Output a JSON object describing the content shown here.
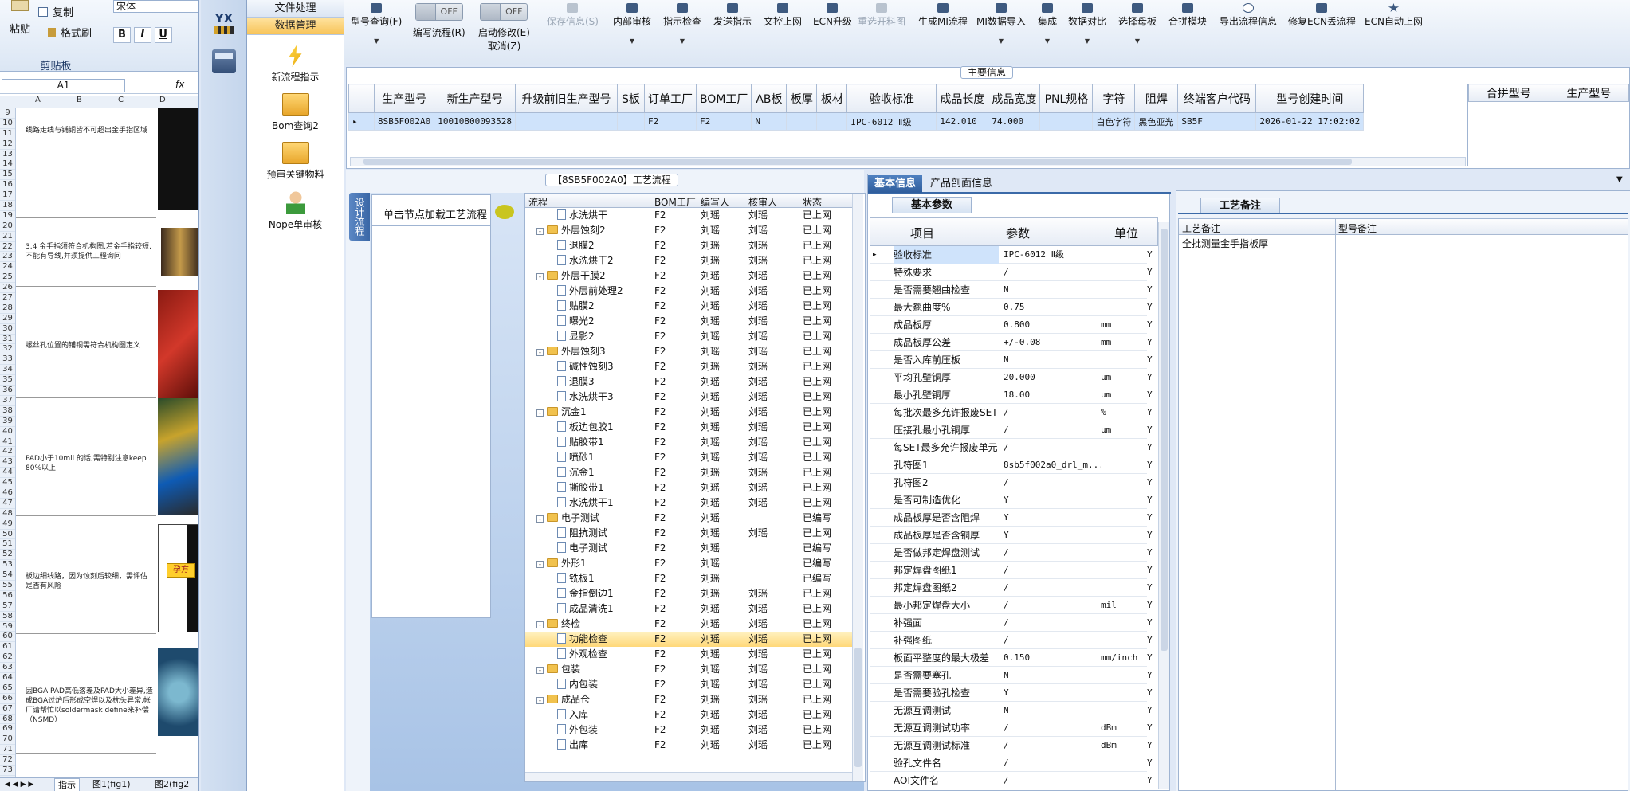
{
  "excel": {
    "copy_label": "复制",
    "format_label": "格式刷",
    "paste_label": "粘贴",
    "font_name": "宋体",
    "clipboard_label": "剪贴板",
    "namebox": "A1",
    "fx": "fx",
    "bold": "B",
    "italic": "I",
    "underline": "U",
    "rows": [
      "9",
      "10",
      "11",
      "12",
      "13",
      "14",
      "15",
      "16",
      "17",
      "18",
      "19",
      "20",
      "21",
      "22",
      "23",
      "24",
      "25",
      "26",
      "27",
      "28",
      "29",
      "30",
      "31",
      "32",
      "33",
      "34",
      "35",
      "36",
      "37",
      "38",
      "39",
      "40",
      "41",
      "42",
      "43",
      "44",
      "45",
      "46",
      "47",
      "48",
      "49",
      "50",
      "51",
      "52",
      "53",
      "54",
      "55",
      "56",
      "57",
      "58",
      "59",
      "60",
      "61",
      "62",
      "63",
      "64",
      "65",
      "66",
      "67",
      "68",
      "69",
      "70",
      "71",
      "72",
      "73"
    ],
    "cols": [
      "A",
      "B",
      "C",
      "D"
    ],
    "notes": [
      "线路走线与铺铜皆不可超出金手指区域",
      "3.4 金手指须符合机构图,若金手指较短,不能有导线,并须提供工程询问",
      "螺丝孔位置的铺铜需符合机构图定义",
      "PAD小于10mil 的话,需特别注意keep 80%以上",
      "板边细线路，因为蚀刻后较细，需评估是否有风险",
      "因BGA PAD高低落差及PAD大小差异,造成BGA过炉后形成空焊以及枕头异常,帐厂请帮忙以soldermask define来补偿（NSMD）"
    ],
    "note_highlight": "（NSMD）",
    "arrow_label": "孕方",
    "sheet_tabs": [
      "指示",
      "图1(fig1)",
      "图2(fig2"
    ]
  },
  "leftnav": {
    "logo": "YX"
  },
  "menu": {
    "header1": "文件处理",
    "header2": "数据管理",
    "items": [
      "新流程指示",
      "Bom查询2",
      "预审关键物料",
      "Nope单审核"
    ]
  },
  "toolbar": {
    "buttons": [
      "型号查询(F)",
      "保存信息(S)",
      "内部审核",
      "指示检查",
      "发送指示",
      "文控上网",
      "ECN升级",
      "重选开料图",
      "生成MI流程",
      "MI数据导入",
      "集成",
      "数据对比",
      "选择母板",
      "合拼模块",
      "导出流程信息",
      "修复ECN丢流程",
      "ECN自动上网"
    ],
    "toggle1_state": "OFF",
    "toggle1_label": "编写流程(R)",
    "toggle2_state": "OFF",
    "toggle2_label": "启动修改(E)",
    "cancel_label": "取消(Z)"
  },
  "main": {
    "title": "主要信息",
    "columns": [
      "生产型号",
      "新生产型号",
      "升级前旧生产型号",
      "S板",
      "订单工厂",
      "BOM工厂",
      "AB板",
      "板厚",
      "板材",
      "验收标准",
      "成品长度",
      "成品宽度",
      "PNL规格",
      "字符",
      "阻焊",
      "终端客户代码",
      "型号创建时间"
    ],
    "row": [
      "8SB5F002A0",
      "10010800093528",
      "",
      "",
      "F2",
      "F2",
      "N",
      "",
      "",
      "IPC-6012 Ⅱ级",
      "142.010",
      "74.000",
      "",
      "白色字符",
      "黑色亚光",
      "SB5F",
      "2026-01-22 17:02:02"
    ],
    "right_columns": [
      "合拼型号",
      "生产型号"
    ]
  },
  "flow": {
    "title": "【8SB5F002A0】工艺流程",
    "side_tab": "设计流程",
    "click_hint": "单击节点加载工艺流程",
    "columns": [
      "流程",
      "BOM工厂",
      "编写人",
      "核审人",
      "状态"
    ],
    "nodes": [
      {
        "name": "水洗烘干",
        "level": 2,
        "type": "doc",
        "bom": "F2",
        "writer": "刘瑶",
        "reviewer": "刘瑶",
        "status": "已上网"
      },
      {
        "name": "外层蚀刻2",
        "level": 1,
        "type": "folder",
        "bom": "F2",
        "writer": "刘瑶",
        "reviewer": "刘瑶",
        "status": "已上网"
      },
      {
        "name": "退膜2",
        "level": 2,
        "type": "doc",
        "bom": "F2",
        "writer": "刘瑶",
        "reviewer": "刘瑶",
        "status": "已上网"
      },
      {
        "name": "水洗烘干2",
        "level": 2,
        "type": "doc",
        "bom": "F2",
        "writer": "刘瑶",
        "reviewer": "刘瑶",
        "status": "已上网"
      },
      {
        "name": "外层干膜2",
        "level": 1,
        "type": "folder",
        "bom": "F2",
        "writer": "刘瑶",
        "reviewer": "刘瑶",
        "status": "已上网"
      },
      {
        "name": "外层前处理2",
        "level": 2,
        "type": "doc",
        "bom": "F2",
        "writer": "刘瑶",
        "reviewer": "刘瑶",
        "status": "已上网"
      },
      {
        "name": "贴膜2",
        "level": 2,
        "type": "doc",
        "bom": "F2",
        "writer": "刘瑶",
        "reviewer": "刘瑶",
        "status": "已上网"
      },
      {
        "name": "曝光2",
        "level": 2,
        "type": "doc",
        "bom": "F2",
        "writer": "刘瑶",
        "reviewer": "刘瑶",
        "status": "已上网"
      },
      {
        "name": "显影2",
        "level": 2,
        "type": "doc",
        "bom": "F2",
        "writer": "刘瑶",
        "reviewer": "刘瑶",
        "status": "已上网"
      },
      {
        "name": "外层蚀刻3",
        "level": 1,
        "type": "folder",
        "bom": "F2",
        "writer": "刘瑶",
        "reviewer": "刘瑶",
        "status": "已上网"
      },
      {
        "name": "碱性蚀刻3",
        "level": 2,
        "type": "doc",
        "bom": "F2",
        "writer": "刘瑶",
        "reviewer": "刘瑶",
        "status": "已上网"
      },
      {
        "name": "退膜3",
        "level": 2,
        "type": "doc",
        "bom": "F2",
        "writer": "刘瑶",
        "reviewer": "刘瑶",
        "status": "已上网"
      },
      {
        "name": "水洗烘干3",
        "level": 2,
        "type": "doc",
        "bom": "F2",
        "writer": "刘瑶",
        "reviewer": "刘瑶",
        "status": "已上网"
      },
      {
        "name": "沉金1",
        "level": 1,
        "type": "folder",
        "bom": "F2",
        "writer": "刘瑶",
        "reviewer": "刘瑶",
        "status": "已上网"
      },
      {
        "name": "板边包胶1",
        "level": 2,
        "type": "doc",
        "bom": "F2",
        "writer": "刘瑶",
        "reviewer": "刘瑶",
        "status": "已上网"
      },
      {
        "name": "贴胶带1",
        "level": 2,
        "type": "doc",
        "bom": "F2",
        "writer": "刘瑶",
        "reviewer": "刘瑶",
        "status": "已上网"
      },
      {
        "name": "喷砂1",
        "level": 2,
        "type": "doc",
        "bom": "F2",
        "writer": "刘瑶",
        "reviewer": "刘瑶",
        "status": "已上网"
      },
      {
        "name": "沉金1",
        "level": 2,
        "type": "doc",
        "bom": "F2",
        "writer": "刘瑶",
        "reviewer": "刘瑶",
        "status": "已上网"
      },
      {
        "name": "撕胶带1",
        "level": 2,
        "type": "doc",
        "bom": "F2",
        "writer": "刘瑶",
        "reviewer": "刘瑶",
        "status": "已上网"
      },
      {
        "name": "水洗烘干1",
        "level": 2,
        "type": "doc",
        "bom": "F2",
        "writer": "刘瑶",
        "reviewer": "刘瑶",
        "status": "已上网"
      },
      {
        "name": "电子测试",
        "level": 1,
        "type": "folder",
        "bom": "F2",
        "writer": "刘瑶",
        "reviewer": "",
        "status": "已编写"
      },
      {
        "name": "阻抗测试",
        "level": 2,
        "type": "doc",
        "bom": "F2",
        "writer": "刘瑶",
        "reviewer": "刘瑶",
        "status": "已上网"
      },
      {
        "name": "电子测试",
        "level": 2,
        "type": "doc",
        "bom": "F2",
        "writer": "刘瑶",
        "reviewer": "",
        "status": "已编写"
      },
      {
        "name": "外形1",
        "level": 1,
        "type": "folder",
        "bom": "F2",
        "writer": "刘瑶",
        "reviewer": "",
        "status": "已编写"
      },
      {
        "name": "铣板1",
        "level": 2,
        "type": "doc",
        "bom": "F2",
        "writer": "刘瑶",
        "reviewer": "",
        "status": "已编写"
      },
      {
        "name": "金指倒边1",
        "level": 2,
        "type": "doc",
        "bom": "F2",
        "writer": "刘瑶",
        "reviewer": "刘瑶",
        "status": "已上网"
      },
      {
        "name": "成品清洗1",
        "level": 2,
        "type": "doc",
        "bom": "F2",
        "writer": "刘瑶",
        "reviewer": "刘瑶",
        "status": "已上网"
      },
      {
        "name": "终检",
        "level": 1,
        "type": "folder",
        "bom": "F2",
        "writer": "刘瑶",
        "reviewer": "刘瑶",
        "status": "已上网"
      },
      {
        "name": "功能检查",
        "level": 2,
        "type": "doc",
        "bom": "F2",
        "writer": "刘瑶",
        "reviewer": "刘瑶",
        "status": "已上网",
        "selected": true
      },
      {
        "name": "外观检查",
        "level": 2,
        "type": "doc",
        "bom": "F2",
        "writer": "刘瑶",
        "reviewer": "刘瑶",
        "status": "已上网"
      },
      {
        "name": "包装",
        "level": 1,
        "type": "folder",
        "bom": "F2",
        "writer": "刘瑶",
        "reviewer": "刘瑶",
        "status": "已上网"
      },
      {
        "name": "内包装",
        "level": 2,
        "type": "doc",
        "bom": "F2",
        "writer": "刘瑶",
        "reviewer": "刘瑶",
        "status": "已上网"
      },
      {
        "name": "成品仓",
        "level": 1,
        "type": "folder",
        "bom": "F2",
        "writer": "刘瑶",
        "reviewer": "刘瑶",
        "status": "已上网"
      },
      {
        "name": "入库",
        "level": 2,
        "type": "doc",
        "bom": "F2",
        "writer": "刘瑶",
        "reviewer": "刘瑶",
        "status": "已上网"
      },
      {
        "name": "外包装",
        "level": 2,
        "type": "doc",
        "bom": "F2",
        "writer": "刘瑶",
        "reviewer": "刘瑶",
        "status": "已上网"
      },
      {
        "name": "出库",
        "level": 2,
        "type": "doc",
        "bom": "F2",
        "writer": "刘瑶",
        "reviewer": "刘瑶",
        "status": "已上网"
      }
    ]
  },
  "info": {
    "tab_basic": "基本信息",
    "tab_profile": "产品剖面信息",
    "subtab": "基本参数",
    "columns": [
      "项目",
      "参数",
      "单位"
    ],
    "rows": [
      {
        "k": "验收标准",
        "v": "IPC-6012 Ⅱ级",
        "u": "",
        "y": "Y"
      },
      {
        "k": "特殊要求",
        "v": "/",
        "u": "",
        "y": "Y"
      },
      {
        "k": "是否需要翘曲检查",
        "v": "N",
        "u": "",
        "y": "Y"
      },
      {
        "k": "最大翘曲度%",
        "v": "0.75",
        "u": "",
        "y": "Y"
      },
      {
        "k": "成品板厚",
        "v": "0.800",
        "u": "mm",
        "y": "Y"
      },
      {
        "k": "成品板厚公差",
        "v": "+/-0.08",
        "u": "mm",
        "y": "Y"
      },
      {
        "k": "是否入库前压板",
        "v": "N",
        "u": "",
        "y": "Y"
      },
      {
        "k": "平均孔壁铜厚",
        "v": "20.000",
        "u": "μm",
        "y": "Y"
      },
      {
        "k": "最小孔壁铜厚",
        "v": "18.00",
        "u": "μm",
        "y": "Y"
      },
      {
        "k": "每批次最多允许报废SET",
        "v": "/",
        "u": "%",
        "y": "Y"
      },
      {
        "k": "压接孔最小孔铜厚",
        "v": "/",
        "u": "μm",
        "y": "Y"
      },
      {
        "k": "每SET最多允许报废单元",
        "v": "/",
        "u": "",
        "y": "Y"
      },
      {
        "k": "孔符图1",
        "v": "8sb5f002a0_drl_m...",
        "u": "",
        "y": "Y"
      },
      {
        "k": "孔符图2",
        "v": "/",
        "u": "",
        "y": "Y"
      },
      {
        "k": "是否可制造优化",
        "v": "Y",
        "u": "",
        "y": "Y"
      },
      {
        "k": "成品板厚是否含阻焊",
        "v": "Y",
        "u": "",
        "y": "Y"
      },
      {
        "k": "成品板厚是否含铜厚",
        "v": "Y",
        "u": "",
        "y": "Y"
      },
      {
        "k": "是否做邦定焊盘测试",
        "v": "/",
        "u": "",
        "y": "Y"
      },
      {
        "k": "邦定焊盘图纸1",
        "v": "/",
        "u": "",
        "y": "Y"
      },
      {
        "k": "邦定焊盘图纸2",
        "v": "/",
        "u": "",
        "y": "Y"
      },
      {
        "k": "最小邦定焊盘大小",
        "v": "/",
        "u": "mil",
        "y": "Y"
      },
      {
        "k": "补强面",
        "v": "/",
        "u": "",
        "y": "Y"
      },
      {
        "k": "补强图纸",
        "v": "/",
        "u": "",
        "y": "Y"
      },
      {
        "k": "板面平整度的最大极差",
        "v": "0.150",
        "u": "mm/inch",
        "y": "Y"
      },
      {
        "k": "是否需要塞孔",
        "v": "N",
        "u": "",
        "y": "Y"
      },
      {
        "k": "是否需要验孔检查",
        "v": "Y",
        "u": "",
        "y": "Y"
      },
      {
        "k": "无源互调测试",
        "v": "N",
        "u": "",
        "y": "Y"
      },
      {
        "k": "无源互调测试功率",
        "v": "/",
        "u": "dBm",
        "y": "Y"
      },
      {
        "k": "无源互调测试标准",
        "v": "/",
        "u": "dBm",
        "y": "Y"
      },
      {
        "k": "验孔文件名",
        "v": "/",
        "u": "",
        "y": "Y"
      },
      {
        "k": "AOI文件名",
        "v": "/",
        "u": "",
        "y": "Y"
      }
    ]
  },
  "remarks": {
    "tab": "工艺备注",
    "col1": "工艺备注",
    "col2": "型号备注",
    "text": "全批测量金手指板厚"
  }
}
